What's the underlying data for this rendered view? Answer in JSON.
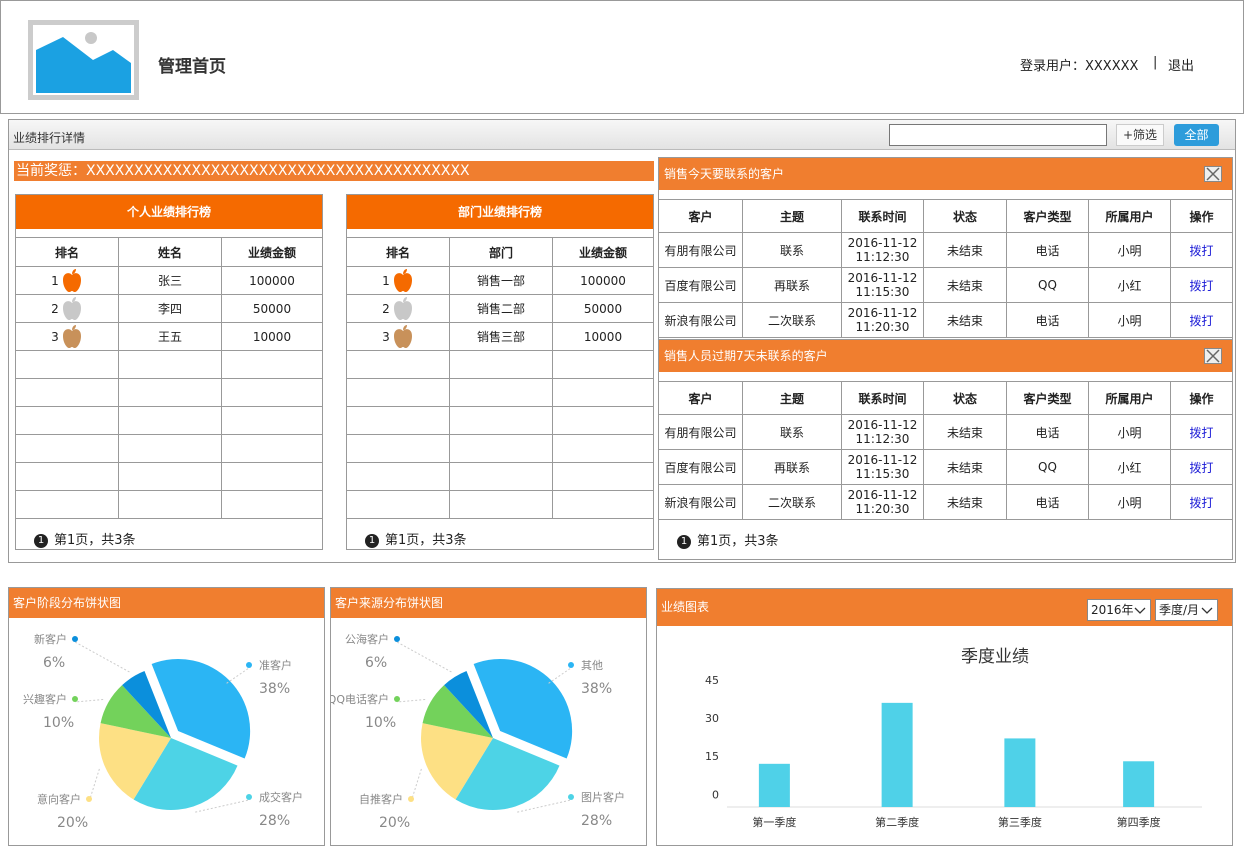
{
  "header": {
    "title": "管理首页",
    "user_label": "登录用户：XXXXXX",
    "separator": "|",
    "logout": "退出"
  },
  "panel": {
    "title": "业绩排行详情",
    "search_placeholder": "",
    "filter_label": "+筛选",
    "all_label": "全部"
  },
  "award": "当前奖惩：XXXXXXXXXXXXXXXXXXXXXXXXXXXXXXXXXXXXXXXX",
  "personal": {
    "title": "个人业绩排行榜",
    "headers": [
      "排名",
      "姓名",
      "业绩金额"
    ],
    "rows": [
      {
        "rank": "1",
        "name": "张三",
        "amount": "100000",
        "medal": "#f56a00"
      },
      {
        "rank": "2",
        "name": "李四",
        "amount": "50000",
        "medal": "#c8c8c8"
      },
      {
        "rank": "3",
        "name": "王五",
        "amount": "10000",
        "medal": "#c8915a"
      }
    ],
    "footer": "第1页，共3条",
    "page_icon": "1"
  },
  "dept": {
    "title": "部门业绩排行榜",
    "headers": [
      "排名",
      "部门",
      "业绩金额"
    ],
    "rows": [
      {
        "rank": "1",
        "name": "销售一部",
        "amount": "100000",
        "medal": "#f56a00"
      },
      {
        "rank": "2",
        "name": "销售二部",
        "amount": "50000",
        "medal": "#c8c8c8"
      },
      {
        "rank": "3",
        "name": "销售三部",
        "amount": "10000",
        "medal": "#c8915a"
      }
    ],
    "footer": "第1页，共3条",
    "page_icon": "1"
  },
  "today": {
    "title": "销售今天要联系的客户",
    "headers": [
      "客户",
      "主题",
      "联系时间",
      "状态",
      "客户类型",
      "所属用户",
      "操作"
    ],
    "rows": [
      [
        "有朋有限公司",
        "联系",
        "2016-11-12 11:12:30",
        "未结束",
        "电话",
        "小明",
        "拨打"
      ],
      [
        "百度有限公司",
        "再联系",
        "2016-11-12 11:15:30",
        "未结束",
        "QQ",
        "小红",
        "拨打"
      ],
      [
        "新浪有限公司",
        "二次联系",
        "2016-11-12 11:20:30",
        "未结束",
        "电话",
        "小明",
        "拨打"
      ]
    ]
  },
  "overdue": {
    "title": "销售人员过期7天未联系的客户",
    "headers": [
      "客户",
      "主题",
      "联系时间",
      "状态",
      "客户类型",
      "所属用户",
      "操作"
    ],
    "rows": [
      [
        "有朋有限公司",
        "联系",
        "2016-11-12 11:12:30",
        "未结束",
        "电话",
        "小明",
        "拨打"
      ],
      [
        "百度有限公司",
        "再联系",
        "2016-11-12 11:15:30",
        "未结束",
        "QQ",
        "小红",
        "拨打"
      ],
      [
        "新浪有限公司",
        "二次联系",
        "2016-11-12 11:20:30",
        "未结束",
        "电话",
        "小明",
        "拨打"
      ]
    ],
    "footer": "第1页，共3条"
  },
  "pie1": {
    "title": "客户阶段分布饼状图"
  },
  "pie2": {
    "title": "客户来源分布饼状图"
  },
  "bar": {
    "title": "业绩图表",
    "year": "2016年",
    "period": "季度/月"
  },
  "chart_data": [
    {
      "type": "pie",
      "title": "",
      "labels": [
        "准客户",
        "成交客户",
        "意向客户",
        "兴趣客户",
        "新客户"
      ],
      "values": [
        38,
        28,
        20,
        10,
        6
      ],
      "value_labels": [
        "38%",
        "28%",
        "20%",
        "10%",
        "6%"
      ],
      "colors": [
        "#2bb5f4",
        "#4dd3e6",
        "#fde084",
        "#73d25b",
        "#0b8fdc"
      ],
      "exploded": "准客户"
    },
    {
      "type": "pie",
      "title": "",
      "labels": [
        "其他",
        "图片客户",
        "自推客户",
        "QQ电话客户",
        "公海客户"
      ],
      "values": [
        38,
        28,
        20,
        10,
        6
      ],
      "value_labels": [
        "38%",
        "28%",
        "20%",
        "10%",
        "6%"
      ],
      "colors": [
        "#2bb5f4",
        "#4dd3e6",
        "#fde084",
        "#73d25b",
        "#0b8fdc"
      ],
      "exploded": "其他"
    },
    {
      "type": "bar",
      "title": "季度业绩",
      "categories": [
        "第一季度",
        "第二季度",
        "第三季度",
        "第四季度"
      ],
      "values": [
        12,
        36,
        22,
        13
      ],
      "ylim": [
        -5,
        45
      ],
      "yticks": [
        0,
        15,
        30,
        45
      ],
      "color": "#4fd1e8"
    }
  ]
}
